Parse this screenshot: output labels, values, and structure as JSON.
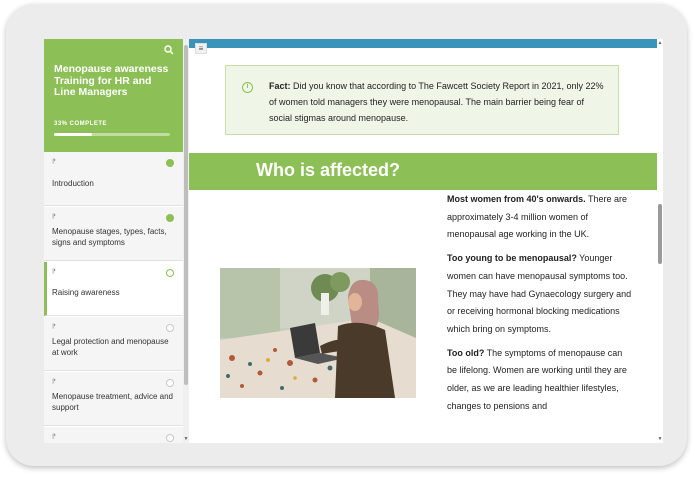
{
  "sidebar": {
    "course_title": "Menopause awareness Training for HR and Line Managers",
    "progress_label": "33% COMPLETE",
    "progress": 0.33,
    "lessons": [
      {
        "type_icon": "⁋",
        "label": "Introduction",
        "status": "complete"
      },
      {
        "type_icon": "⁋",
        "label": "Menopause stages, types, facts, signs and symptoms",
        "status": "complete"
      },
      {
        "type_icon": "⁋",
        "label": "Raising awareness",
        "status": "current"
      },
      {
        "type_icon": "⁋",
        "label": "Legal protection and menopause at work",
        "status": "not-started"
      },
      {
        "type_icon": "⁋",
        "label": "Menopause treatment, advice and support",
        "status": "not-started"
      },
      {
        "type_icon": "⁋",
        "label": "",
        "status": "not-started"
      }
    ]
  },
  "main": {
    "menu_icon": "≡",
    "fact": {
      "label": "Fact:",
      "text": " Did you know that according to The Fawcett Society Report in 2021, only 22% of women told managers they were menopausal. The main barrier being fear of social stigmas around menopause."
    },
    "section_title": "Who is affected?",
    "paragraphs": [
      {
        "bold": "Most women from 40's onwards.",
        "text": " There are approximately 3-4 million women of menopausal age working in the UK."
      },
      {
        "bold": "Too young to be menopausal?",
        "text": " Younger women can have menopausal symptoms too. They may have had Gynaecology surgery and or receiving hormonal blocking medications which bring on symptoms."
      },
      {
        "bold": "Too old?",
        "text": " The symptoms of menopause can be lifelong. Women are working until they are older, as we are leading healthier lifestyles, changes to pensions and"
      }
    ]
  },
  "colors": {
    "accent_green": "#8cbf55",
    "top_bar_blue": "#3a94b9",
    "fact_bg": "#eff6e7"
  },
  "icons": {
    "search": "search-icon",
    "info": "info-icon",
    "check": "check-circle-icon"
  }
}
